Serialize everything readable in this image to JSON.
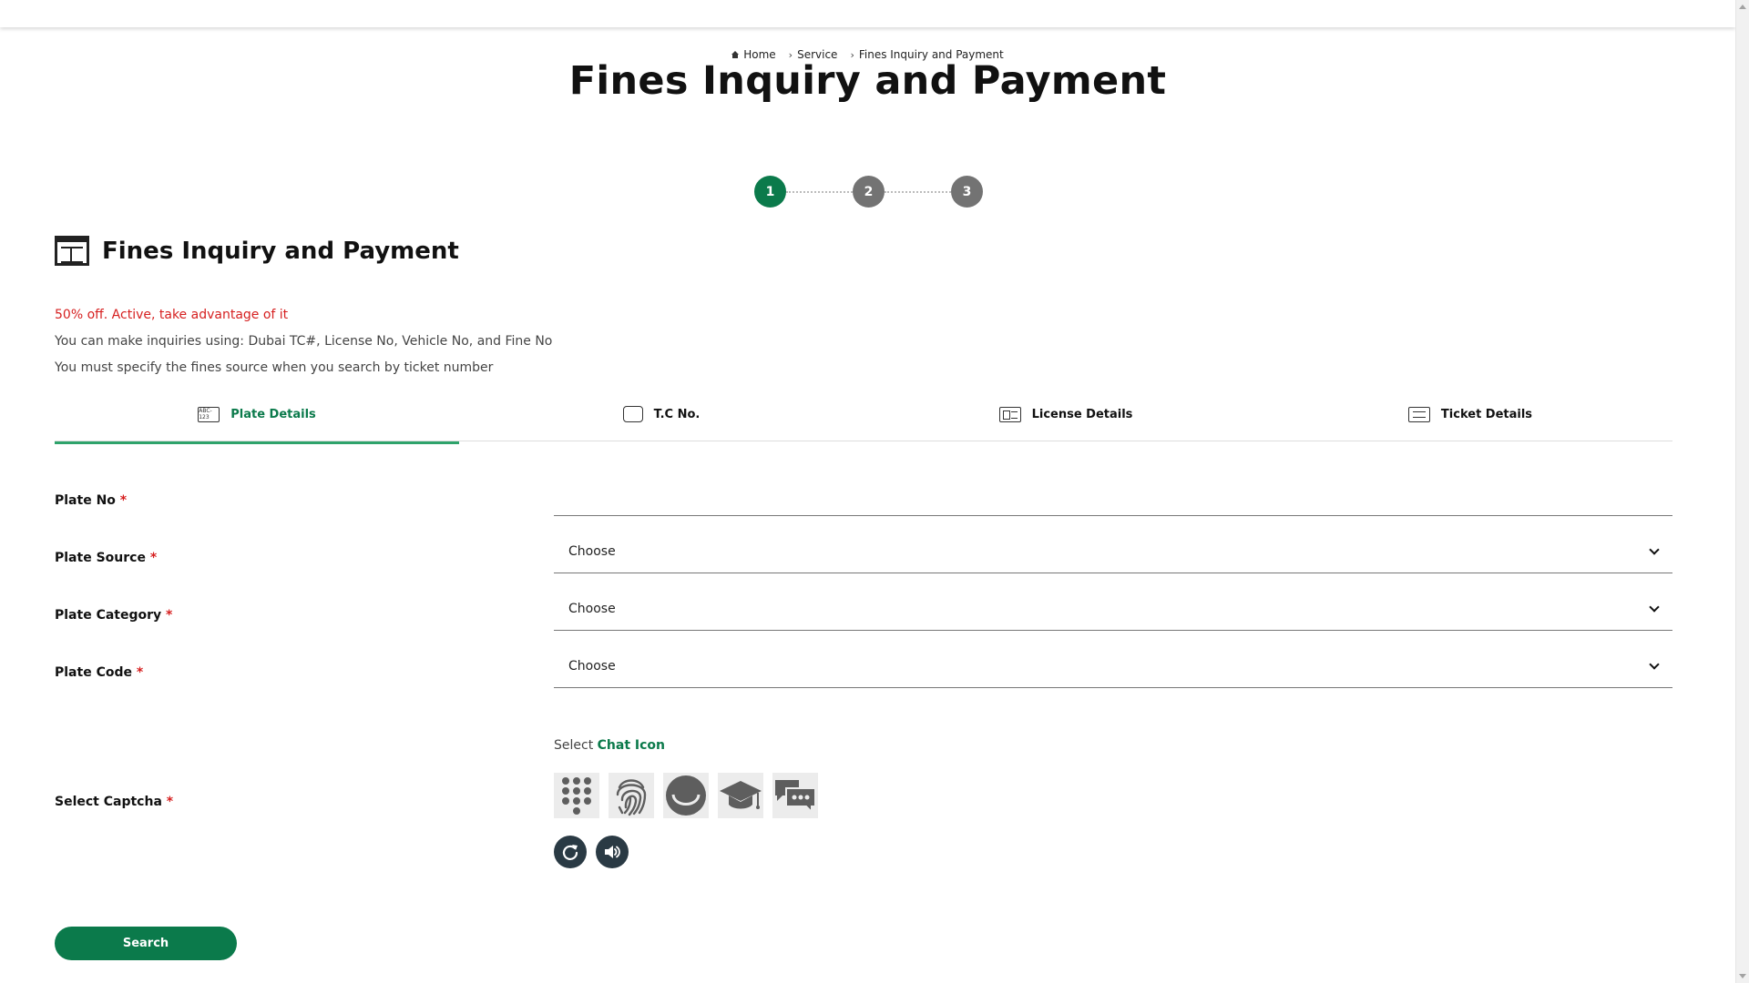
{
  "breadcrumb": {
    "home": "Home",
    "service": "Service",
    "current": "Fines Inquiry and Payment"
  },
  "page_title": "Fines Inquiry and Payment",
  "stepper": {
    "steps": [
      "1",
      "2",
      "3"
    ],
    "active_step": 1
  },
  "section": {
    "title": "Fines Inquiry and Payment",
    "icon": "calendar-icon"
  },
  "notes": {
    "promo": "50% off. Active, take advantage of it",
    "info1": "You can make inquiries using: Dubai TC#, License No, Vehicle No, and Fine No",
    "info2": "You must specify the fines source when you search by ticket number"
  },
  "tabs": [
    {
      "label": "Plate Details",
      "icon": "plate-icon",
      "icon_text": "ABC-123",
      "active": true
    },
    {
      "label": "T.C No.",
      "icon": "card-icon",
      "active": false
    },
    {
      "label": "License Details",
      "icon": "license-icon",
      "active": false
    },
    {
      "label": "Ticket Details",
      "icon": "ticket-icon",
      "active": false
    }
  ],
  "form": {
    "plate_no": {
      "label": "Plate No",
      "required_mark": "*",
      "value": ""
    },
    "plate_source": {
      "label": "Plate Source",
      "required_mark": "*",
      "selected": "Choose"
    },
    "plate_category": {
      "label": "Plate Category",
      "required_mark": "*",
      "selected": "Choose"
    },
    "plate_code": {
      "label": "Plate Code",
      "required_mark": "*",
      "selected": "Choose"
    }
  },
  "captcha": {
    "label": "Select Captcha",
    "required_mark": "*",
    "prompt_prefix": "Select",
    "prompt_target": "Chat Icon",
    "options": [
      "keypad-icon",
      "fingerprint-icon",
      "smile-icon",
      "graduation-cap-icon",
      "chat-icon"
    ],
    "controls": [
      "refresh-icon",
      "audio-icon"
    ]
  },
  "search_button": "Search",
  "colors": {
    "accent": "#0b7a4b",
    "tab_underline": "#2ea36b",
    "promo": "#d61f1f",
    "step_inactive": "#737373",
    "captcha_control": "#2a3a44"
  }
}
